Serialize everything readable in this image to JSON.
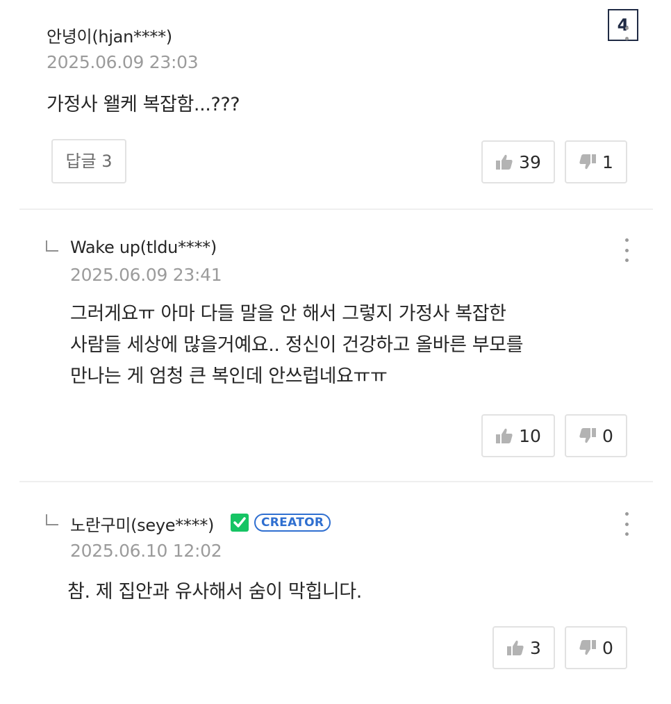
{
  "page_badge": "4",
  "comments": [
    {
      "author": "안녕이(hjan****)",
      "date": "2025.06.09 23:03",
      "text": "가정사 왤케 복잡함...???",
      "reply_button": "답글 3",
      "likes": "39",
      "dislikes": "1"
    },
    {
      "author": "Wake up(tldu****)",
      "date": "2025.06.09 23:41",
      "lines": [
        "그러게요ㅠ 아마 다들 말을 안 해서 그렇지 가정사 복잡한",
        "사람들 세상에 많을거예요.. 정신이 건강하고 올바른 부모를",
        "만나는 게 엄청 큰 복인데 안쓰럽네요ㅠㅠ"
      ],
      "likes": "10",
      "dislikes": "0"
    },
    {
      "author": "노란구미(seye****)",
      "badge": "CREATOR",
      "date": "2025.06.10 12:02",
      "text": "참. 제 집안과 유사해서 숨이 막힙니다.",
      "likes": "3",
      "dislikes": "0"
    }
  ],
  "icons": {
    "like": "thumbs-up-icon",
    "dislike": "thumbs-down-icon",
    "more": "more-vertical-icon",
    "reply": "reply-arrow-icon",
    "verified": "verified-check-icon"
  },
  "colors": {
    "verified_green": "#16c464",
    "creator_blue": "#2f6fd0",
    "date_gray": "#9b9b9b",
    "border_gray": "#e2e2e2"
  }
}
